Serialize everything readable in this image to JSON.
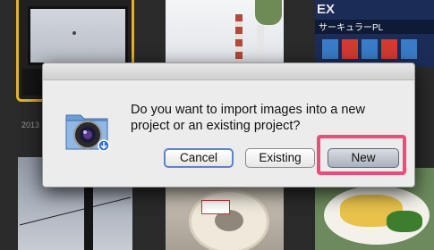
{
  "background_caption": "2013",
  "thumbnails": {
    "store_sign": {
      "big_label": "EX",
      "sub_label": "サーキュラーPL"
    }
  },
  "dialog": {
    "message": "Do you want to import images into a new project or an existing project?",
    "buttons": {
      "cancel": "Cancel",
      "existing": "Existing",
      "new": "New"
    },
    "icon": "aperture-folder-camera-icon"
  },
  "colors": {
    "selection_highlight": "#ef4a78",
    "thumbnail_selected": "#e3b12d",
    "default_button_focus": "#5b84c8"
  }
}
